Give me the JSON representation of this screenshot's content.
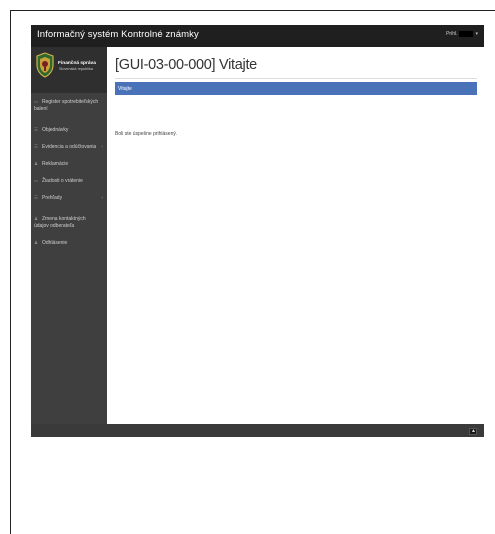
{
  "header": {
    "app_title": "Informačný systém Kontrolné známky",
    "user_prefix": "Prihl.",
    "user_caret": "▾"
  },
  "brand": {
    "title": "Finančná správa",
    "subtitle": "Slovenská republika"
  },
  "sidebar": {
    "items": [
      {
        "icon": "document-icon",
        "label": "Register spotrebiteľských",
        "label2": "balení",
        "chevron": ""
      },
      {
        "icon": "list-icon",
        "label": "Objednávky",
        "label2": "",
        "chevron": ""
      },
      {
        "icon": "list-icon",
        "label": "Evidencia a odúčtovania",
        "label2": "",
        "chevron": "‹"
      },
      {
        "icon": "person-icon",
        "label": "Reklamácie",
        "label2": "",
        "chevron": ""
      },
      {
        "icon": "document-icon",
        "label": "Žiadosti o vrátenie",
        "label2": "",
        "chevron": ""
      },
      {
        "icon": "list-icon",
        "label": "Prehľady",
        "label2": "",
        "chevron": "‹"
      },
      {
        "icon": "person-icon",
        "label": "Zmena kontaktných",
        "label2": "údajov odberateľa",
        "chevron": ""
      },
      {
        "icon": "person-icon",
        "label": "Odhlásenie",
        "label2": "",
        "chevron": ""
      }
    ]
  },
  "main": {
    "page_title": "[GUI-03-00-000] Vitajte",
    "panel_title": "Vitajte",
    "welcome_message": "Boli ste úspešne prihlásený."
  },
  "footer": {
    "button_glyph": "▲"
  },
  "colors": {
    "panel": "#4a72b8",
    "sidebar": "#3f3f3f",
    "topbar": "#1f1f1f"
  }
}
